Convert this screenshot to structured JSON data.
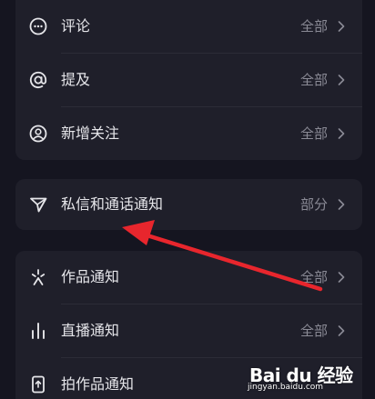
{
  "theme": {
    "background": "#151520",
    "card": "#1f1f2a",
    "text": "#e6e6ea",
    "muted": "#8a8a95",
    "annotation_arrow": "#e8262d"
  },
  "group1": {
    "items": [
      {
        "label": "评论",
        "value": "全部",
        "icon": "comment-icon"
      },
      {
        "label": "提及",
        "value": "全部",
        "icon": "at-icon"
      },
      {
        "label": "新增关注",
        "value": "全部",
        "icon": "user-follow-icon"
      }
    ]
  },
  "group2": {
    "items": [
      {
        "label": "私信和通话通知",
        "value": "部分",
        "icon": "send-icon"
      }
    ]
  },
  "group3": {
    "items": [
      {
        "label": "作品通知",
        "value": "全部",
        "icon": "sparkle-icon"
      },
      {
        "label": "直播通知",
        "value": "全部",
        "icon": "bars-icon"
      },
      {
        "label": "拍作品通知",
        "value": "",
        "icon": "phone-upload-icon"
      }
    ]
  },
  "watermark": {
    "logo": "Bai du 经验",
    "url": "jingyan.baidu.com"
  }
}
